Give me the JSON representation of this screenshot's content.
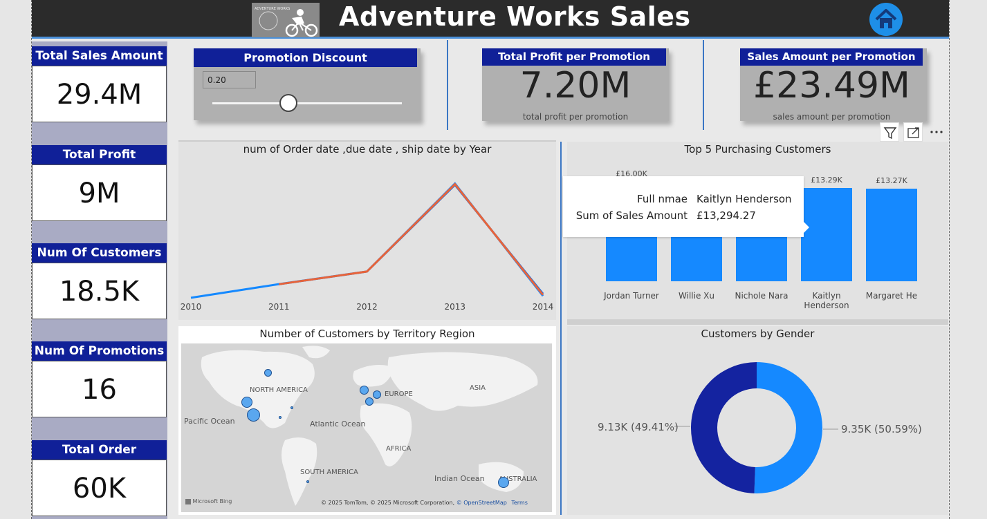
{
  "header": {
    "title": "Adventure Works Sales",
    "logo_text": "ADVENTURE WORKS"
  },
  "kpis": [
    {
      "label": "Total Sales Amount",
      "value": "29.4M"
    },
    {
      "label": "Total Profit",
      "value": "9M"
    },
    {
      "label": "Num Of Customers",
      "value": "18.5K"
    },
    {
      "label": "Num Of Promotions",
      "value": "16"
    },
    {
      "label": "Total Order Quantity",
      "value": "60K"
    }
  ],
  "promotion_slicer": {
    "label": "Promotion Discount",
    "value": "0.20",
    "level": 0.4
  },
  "profit_card": {
    "label": "Total Profit per Promotion",
    "value": "7.20M",
    "caption": "total profit per promotion"
  },
  "sales_card": {
    "label": "Sales Amount per Promotion",
    "value": "£23.49M",
    "caption": "sales amount per promotion"
  },
  "visual_header_icons": [
    "filter-icon",
    "focus-mode-icon",
    "more-options-icon"
  ],
  "colors": {
    "navy": "#102098",
    "accent_blue": "#1589ff",
    "dark_navy": "#1423a0",
    "orange": "#e8643a",
    "line_blue": "#1e6fe0"
  },
  "chart_data": [
    {
      "type": "line",
      "title": "num of Order date ,due date , ship date by Year",
      "x": [
        "2010",
        "2011",
        "2012",
        "2013",
        "2014"
      ],
      "series": [
        {
          "values": [
            5,
            1015,
            1950,
            8450,
            140
          ]
        },
        {
          "values": [
            null,
            1005,
            1940,
            8350,
            300
          ]
        },
        {
          "values": [
            null,
            1005,
            1945,
            8400,
            220
          ]
        }
      ],
      "ylim": [
        0,
        9500
      ]
    },
    {
      "type": "bar",
      "title": "Top 5 Purchasing Customers",
      "categories": [
        "Jordan Turner",
        "Willie Xu",
        "Nichole Nara",
        "Kaitlyn Henderson",
        "Margaret He"
      ],
      "values": [
        13500,
        13400,
        13300,
        13290,
        13270
      ],
      "data_labels": [
        "£16.00K",
        "",
        "",
        "£13.29K",
        "£13.27K"
      ],
      "ylim": [
        0,
        16000
      ]
    },
    {
      "type": "pie",
      "title": "Customers by Gender",
      "slices": [
        {
          "label": "9.35K (50.59%)",
          "value": 50.59,
          "color": "#1589ff"
        },
        {
          "label": "9.13K (49.41%)",
          "value": 49.41,
          "color": "#1423a0"
        }
      ]
    }
  ],
  "tooltip": {
    "label1": "Full nmae",
    "value1": "Kaitlyn Henderson",
    "label2": "Sum of Sales Amount",
    "value2": "£13,294.27"
  },
  "map": {
    "title": "Number of Customers by Territory Region",
    "labels": [
      "NORTH AMERICA",
      "EUROPE",
      "ASIA",
      "Pacific Ocean",
      "Atlantic Ocean",
      "AFRICA",
      "SOUTH AMERICA",
      "Indian Ocean",
      "AUSTRALIA"
    ],
    "brand": "Microsoft Bing",
    "copyright": "© 2025 TomTom, © 2025 Microsoft Corporation,",
    "osm_link": "© OpenStreetMap",
    "terms_link": "Terms"
  }
}
